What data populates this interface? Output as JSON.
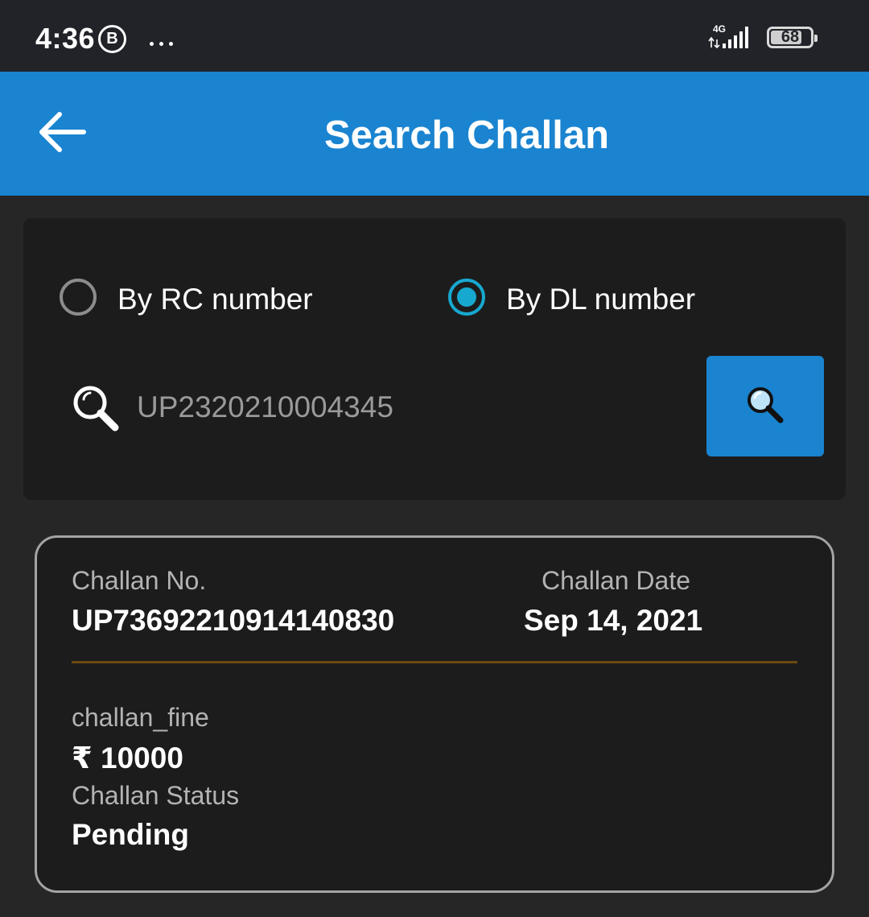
{
  "status_bar": {
    "time": "4:36",
    "badge": "B",
    "network": "4G",
    "battery": "68"
  },
  "header": {
    "title": "Search Challan"
  },
  "search": {
    "option_rc_label": "By RC number",
    "option_dl_label": "By DL number",
    "selected_option": "By DL number",
    "input_value": "UP2320210004345"
  },
  "result": {
    "challan_no_label": "Challan No.",
    "challan_no_value": "UP73692210914140830",
    "challan_date_label": "Challan Date",
    "challan_date_value": "Sep 14, 2021",
    "fine_label": "challan_fine",
    "fine_value": "₹ 10000",
    "status_label": "Challan Status",
    "status_value": "Pending"
  },
  "colors": {
    "app_bar": "#1a84d0",
    "radio_selected": "#17a8cf",
    "divider": "#6b4a12",
    "background": "#262626"
  }
}
